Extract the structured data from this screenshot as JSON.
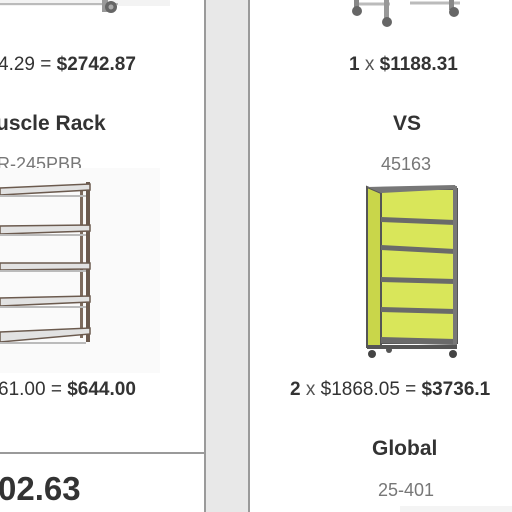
{
  "left_column": {
    "item1": {
      "price_prefix": "4.29 =",
      "total": "$2742.87"
    },
    "item2": {
      "name": "uscle Rack",
      "sku": "R-245PBB",
      "price_prefix": "61.00 =",
      "total": "$644.00"
    },
    "grand_total": "02.63"
  },
  "right_column": {
    "item1": {
      "qty": "1",
      "times": "x",
      "total": "$1188.31"
    },
    "item2": {
      "name": "VS",
      "sku": "45163",
      "qty": "2",
      "times": "x",
      "unit_price": "$1868.05 =",
      "total": "$3736.1"
    },
    "item3": {
      "name": "Global",
      "sku": "25-401"
    }
  },
  "colors": {
    "background": "#e8e8e8",
    "panel": "#ffffff",
    "divider": "#9a9a9a",
    "cabinet_yellow": "#d9e65a",
    "rack_frame": "#6b5a4e"
  },
  "icons": [
    "cart-product-image",
    "caster-wheel-icon"
  ]
}
